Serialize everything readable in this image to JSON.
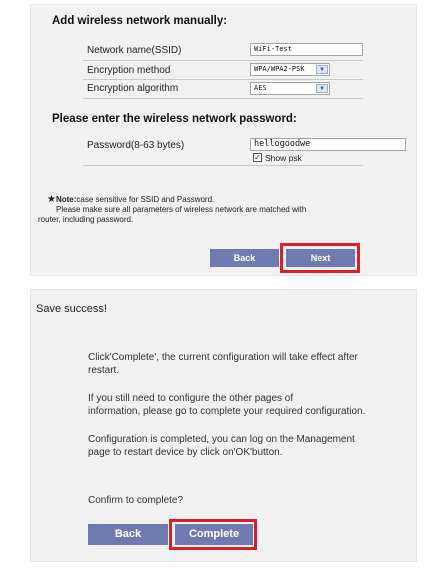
{
  "manual": {
    "title": "Add wireless network manually:",
    "rows": [
      {
        "label": "Network name(SSID)",
        "value": "WiFi-Test"
      },
      {
        "label": "Encryption method",
        "value": "WPA/WPA2-PSK"
      },
      {
        "label": "Encryption algorithm",
        "value": "AES"
      }
    ],
    "select_arrow": "chevron-down-icon",
    "password_title": "Please enter the wireless network password:",
    "password_label": "Password(8-63 bytes)",
    "password_value": "hellogoodwe",
    "show_psk_label": "Show psk",
    "show_psk_checked": true,
    "note_star": "★",
    "note_bold": "Note:",
    "note_line1": "case sensitive for SSID and Password.",
    "note_line2": "Please make sure all parameters of wireless network are matched with",
    "note_line3": "router, including password.",
    "back_label": "Back",
    "next_label": "Next"
  },
  "save": {
    "title": "Save success!",
    "p1_line1": "Click'Complete', the current configuration will take effect after",
    "p1_line2": "restart.",
    "p2_line1": "If you still need to configure the other pages of",
    "p2_line2": "information, please go to complete your required configuration.",
    "p3_line1": "Configuration is completed, you can log on the Management",
    "p3_line2": "page to restart device by click on'OK'button.",
    "confirm": "Confirm to complete?",
    "back_label": "Back",
    "complete_label": "Complete"
  },
  "colors": {
    "button": "#6f7ab0",
    "highlight": "#d72027",
    "panel": "#f1f1f1"
  }
}
